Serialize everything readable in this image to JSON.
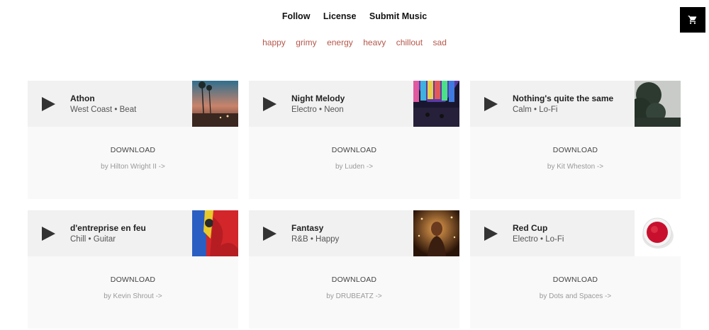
{
  "nav": {
    "follow": "Follow",
    "license": "License",
    "submit": "Submit Music"
  },
  "tags": [
    "happy",
    "grimy",
    "energy",
    "heavy",
    "chillout",
    "sad"
  ],
  "cards": [
    {
      "title": "Athon",
      "subtitle": "West Coast • Beat",
      "download": "DOWNLOAD",
      "author": "by Hilton Wright II ->"
    },
    {
      "title": "Night Melody",
      "subtitle": "Electro • Neon",
      "download": "DOWNLOAD",
      "author": "by Luden ->"
    },
    {
      "title": "Nothing's quite the same",
      "subtitle": "Calm • Lo-Fi",
      "download": "DOWNLOAD",
      "author": "by Kit Wheston ->"
    },
    {
      "title": "d'entreprise en feu",
      "subtitle": "Chill • Guitar",
      "download": "DOWNLOAD",
      "author": "by Kevin Shrout ->"
    },
    {
      "title": "Fantasy",
      "subtitle": "R&B • Happy",
      "download": "DOWNLOAD",
      "author": "by DRUBEATZ ->"
    },
    {
      "title": "Red Cup",
      "subtitle": "Electro • Lo-Fi",
      "download": "DOWNLOAD",
      "author": "by Dots and Spaces ->"
    }
  ],
  "colors": {
    "tag": "#b5574b",
    "cart_bg": "#000000",
    "card_top": "#f1f1f1",
    "card_bottom": "#f9f9f9"
  },
  "icons": {
    "cart": "cart-icon",
    "play": "play-icon"
  }
}
